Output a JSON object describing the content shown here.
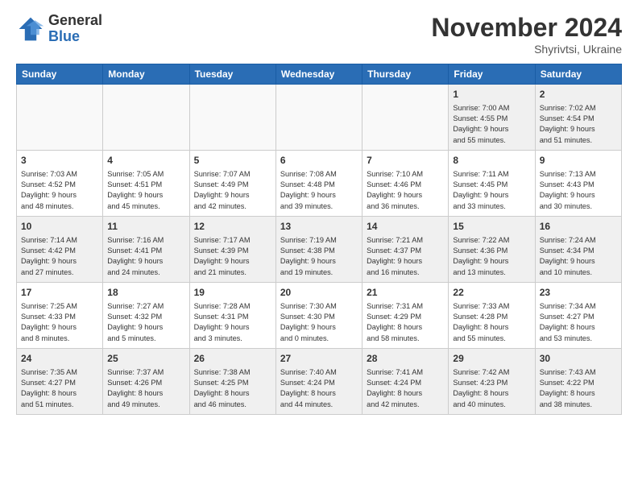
{
  "logo": {
    "general": "General",
    "blue": "Blue"
  },
  "title": "November 2024",
  "location": "Shyrivtsi, Ukraine",
  "days_of_week": [
    "Sunday",
    "Monday",
    "Tuesday",
    "Wednesday",
    "Thursday",
    "Friday",
    "Saturday"
  ],
  "weeks": [
    [
      {
        "day": "",
        "info": ""
      },
      {
        "day": "",
        "info": ""
      },
      {
        "day": "",
        "info": ""
      },
      {
        "day": "",
        "info": ""
      },
      {
        "day": "",
        "info": ""
      },
      {
        "day": "1",
        "info": "Sunrise: 7:00 AM\nSunset: 4:55 PM\nDaylight: 9 hours\nand 55 minutes."
      },
      {
        "day": "2",
        "info": "Sunrise: 7:02 AM\nSunset: 4:54 PM\nDaylight: 9 hours\nand 51 minutes."
      }
    ],
    [
      {
        "day": "3",
        "info": "Sunrise: 7:03 AM\nSunset: 4:52 PM\nDaylight: 9 hours\nand 48 minutes."
      },
      {
        "day": "4",
        "info": "Sunrise: 7:05 AM\nSunset: 4:51 PM\nDaylight: 9 hours\nand 45 minutes."
      },
      {
        "day": "5",
        "info": "Sunrise: 7:07 AM\nSunset: 4:49 PM\nDaylight: 9 hours\nand 42 minutes."
      },
      {
        "day": "6",
        "info": "Sunrise: 7:08 AM\nSunset: 4:48 PM\nDaylight: 9 hours\nand 39 minutes."
      },
      {
        "day": "7",
        "info": "Sunrise: 7:10 AM\nSunset: 4:46 PM\nDaylight: 9 hours\nand 36 minutes."
      },
      {
        "day": "8",
        "info": "Sunrise: 7:11 AM\nSunset: 4:45 PM\nDaylight: 9 hours\nand 33 minutes."
      },
      {
        "day": "9",
        "info": "Sunrise: 7:13 AM\nSunset: 4:43 PM\nDaylight: 9 hours\nand 30 minutes."
      }
    ],
    [
      {
        "day": "10",
        "info": "Sunrise: 7:14 AM\nSunset: 4:42 PM\nDaylight: 9 hours\nand 27 minutes."
      },
      {
        "day": "11",
        "info": "Sunrise: 7:16 AM\nSunset: 4:41 PM\nDaylight: 9 hours\nand 24 minutes."
      },
      {
        "day": "12",
        "info": "Sunrise: 7:17 AM\nSunset: 4:39 PM\nDaylight: 9 hours\nand 21 minutes."
      },
      {
        "day": "13",
        "info": "Sunrise: 7:19 AM\nSunset: 4:38 PM\nDaylight: 9 hours\nand 19 minutes."
      },
      {
        "day": "14",
        "info": "Sunrise: 7:21 AM\nSunset: 4:37 PM\nDaylight: 9 hours\nand 16 minutes."
      },
      {
        "day": "15",
        "info": "Sunrise: 7:22 AM\nSunset: 4:36 PM\nDaylight: 9 hours\nand 13 minutes."
      },
      {
        "day": "16",
        "info": "Sunrise: 7:24 AM\nSunset: 4:34 PM\nDaylight: 9 hours\nand 10 minutes."
      }
    ],
    [
      {
        "day": "17",
        "info": "Sunrise: 7:25 AM\nSunset: 4:33 PM\nDaylight: 9 hours\nand 8 minutes."
      },
      {
        "day": "18",
        "info": "Sunrise: 7:27 AM\nSunset: 4:32 PM\nDaylight: 9 hours\nand 5 minutes."
      },
      {
        "day": "19",
        "info": "Sunrise: 7:28 AM\nSunset: 4:31 PM\nDaylight: 9 hours\nand 3 minutes."
      },
      {
        "day": "20",
        "info": "Sunrise: 7:30 AM\nSunset: 4:30 PM\nDaylight: 9 hours\nand 0 minutes."
      },
      {
        "day": "21",
        "info": "Sunrise: 7:31 AM\nSunset: 4:29 PM\nDaylight: 8 hours\nand 58 minutes."
      },
      {
        "day": "22",
        "info": "Sunrise: 7:33 AM\nSunset: 4:28 PM\nDaylight: 8 hours\nand 55 minutes."
      },
      {
        "day": "23",
        "info": "Sunrise: 7:34 AM\nSunset: 4:27 PM\nDaylight: 8 hours\nand 53 minutes."
      }
    ],
    [
      {
        "day": "24",
        "info": "Sunrise: 7:35 AM\nSunset: 4:27 PM\nDaylight: 8 hours\nand 51 minutes."
      },
      {
        "day": "25",
        "info": "Sunrise: 7:37 AM\nSunset: 4:26 PM\nDaylight: 8 hours\nand 49 minutes."
      },
      {
        "day": "26",
        "info": "Sunrise: 7:38 AM\nSunset: 4:25 PM\nDaylight: 8 hours\nand 46 minutes."
      },
      {
        "day": "27",
        "info": "Sunrise: 7:40 AM\nSunset: 4:24 PM\nDaylight: 8 hours\nand 44 minutes."
      },
      {
        "day": "28",
        "info": "Sunrise: 7:41 AM\nSunset: 4:24 PM\nDaylight: 8 hours\nand 42 minutes."
      },
      {
        "day": "29",
        "info": "Sunrise: 7:42 AM\nSunset: 4:23 PM\nDaylight: 8 hours\nand 40 minutes."
      },
      {
        "day": "30",
        "info": "Sunrise: 7:43 AM\nSunset: 4:22 PM\nDaylight: 8 hours\nand 38 minutes."
      }
    ]
  ]
}
